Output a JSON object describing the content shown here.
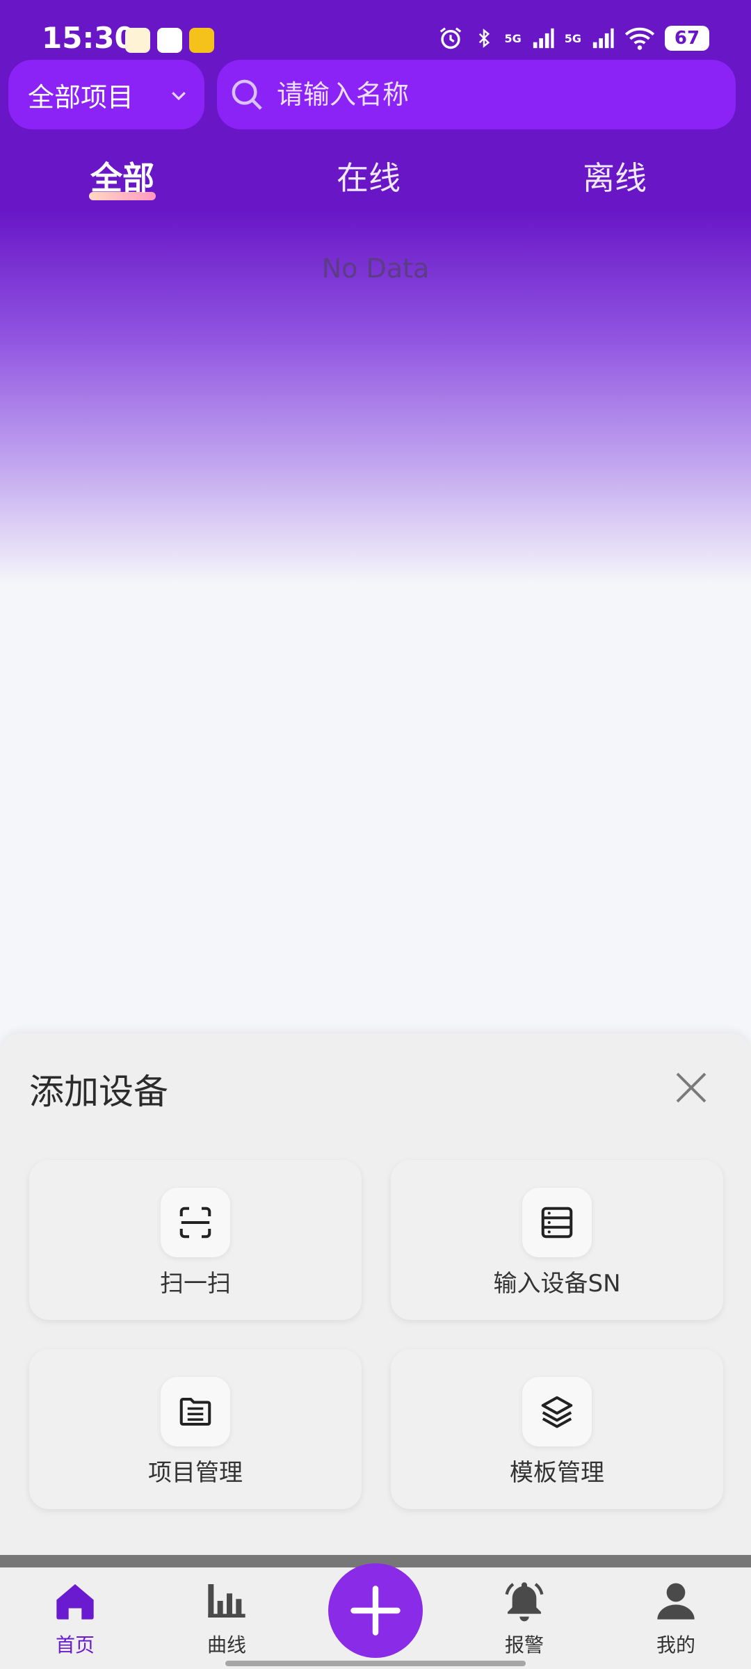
{
  "status_bar": {
    "time": "15:30",
    "network_1": "5G",
    "network_2": "5G",
    "battery": "67"
  },
  "search": {
    "project_filter": "全部项目",
    "placeholder": "请输入名称"
  },
  "tabs": [
    {
      "label": "全部",
      "active": true
    },
    {
      "label": "在线",
      "active": false
    },
    {
      "label": "离线",
      "active": false
    }
  ],
  "empty_state": "No Data",
  "add_device_sheet": {
    "title": "添加设备",
    "options": [
      {
        "label": "扫一扫",
        "icon": "scan-icon"
      },
      {
        "label": "输入设备SN",
        "icon": "server-icon"
      },
      {
        "label": "项目管理",
        "icon": "file-list-icon"
      },
      {
        "label": "模板管理",
        "icon": "layers-icon"
      }
    ]
  },
  "bottom_nav": [
    {
      "label": "首页",
      "icon": "home-icon",
      "active": true
    },
    {
      "label": "曲线",
      "icon": "bar-chart-icon",
      "active": false
    },
    {
      "label": "报警",
      "icon": "bell-icon",
      "active": false
    },
    {
      "label": "我的",
      "icon": "user-icon",
      "active": false
    }
  ],
  "colors": {
    "primary": "#6816c6",
    "accent": "#8b22f6",
    "fab": "#8a2be8"
  }
}
